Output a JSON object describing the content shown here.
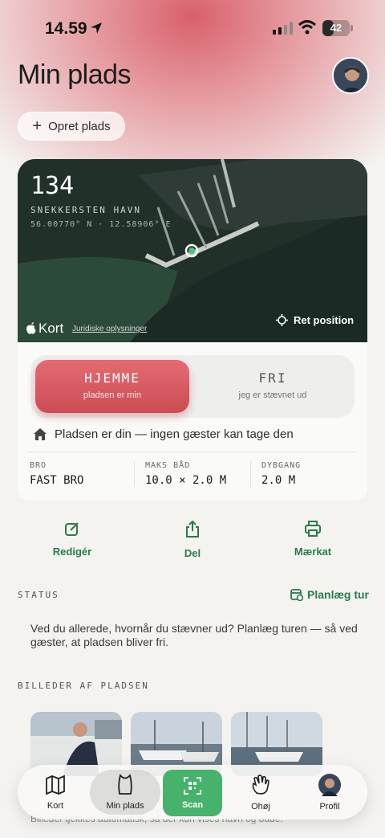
{
  "status_bar": {
    "time": "14.59",
    "battery": "42",
    "battery_level": 0.42
  },
  "header": {
    "title": "Min plads",
    "create_button": "Opret plads"
  },
  "map": {
    "berth_number": "134",
    "harbor": "SNEKKERSTEN HAVN",
    "coordinates": "56.00770° N · 12.58906° E",
    "maps_brand": "Kort",
    "legal_link": "Juridiske oplysninger",
    "reset_position": "Ret position"
  },
  "mode": {
    "home": {
      "title": "HJEMME",
      "subtitle": "pladsen er min"
    },
    "free": {
      "title": "FRI",
      "subtitle": "jeg er stævnet ud"
    },
    "active": "home",
    "info": "Pladsen er din — ingen gæster kan tage den"
  },
  "specs": [
    {
      "label": "BRO",
      "value": "FAST BRO"
    },
    {
      "label": "MAKS BÅD",
      "value": "10.0 × 2.0 M"
    },
    {
      "label": "DYBGANG",
      "value": "2.0 M"
    }
  ],
  "actions": {
    "edit": "Redigér",
    "share": "Del",
    "label": "Mærkat"
  },
  "status": {
    "heading": "STATUS",
    "plan_link": "Planlæg tur",
    "text": "Ved du allerede, hvornår du stævner ud? Planlæg turen — så ved gæster, at pladsen bliver fri."
  },
  "photos": {
    "heading": "BILLEDER AF PLADSEN",
    "footer": "Billeder tjekkes automatisk, så der kun vises havn og både."
  },
  "tabbar": {
    "map": "Kort",
    "my_berth": "Min plads",
    "scan": "Scan",
    "ahoy": "Ohøj",
    "profile": "Profil",
    "active": "my_berth",
    "scan_color": "#47b26c"
  },
  "colors": {
    "accent": "#2a7a4a",
    "home_mode": "#d9575f"
  }
}
